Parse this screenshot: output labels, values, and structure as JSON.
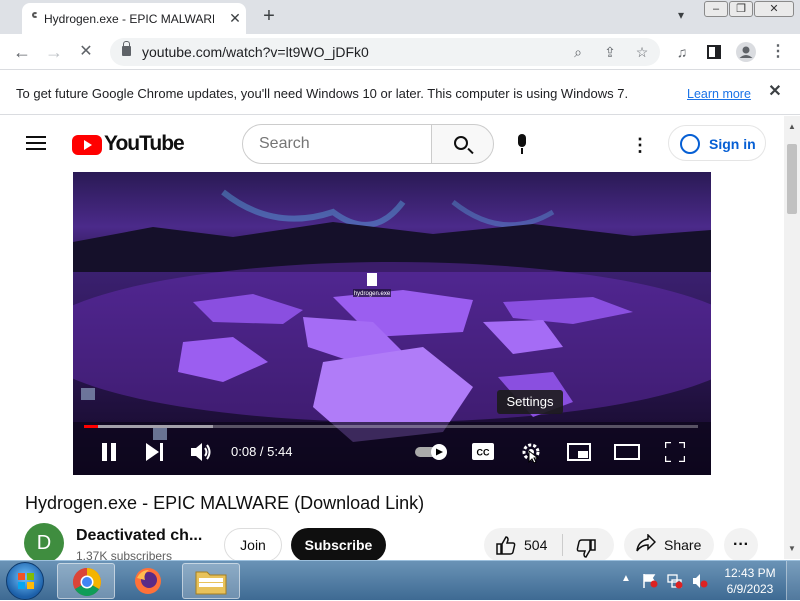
{
  "browser": {
    "tab_title": "Hydrogen.exe - EPIC MALWARE (",
    "url": "youtube.com/watch?v=lt9WO_jDFk0"
  },
  "update_bar": {
    "message": "To get future Google Chrome updates, you'll need Windows 10 or later. This computer is using Windows 7.",
    "link": "Learn more"
  },
  "youtube": {
    "logo_text": "YouTube",
    "search_placeholder": "Search",
    "sign_in": "Sign in"
  },
  "player": {
    "tooltip": "Settings",
    "current_time": "0:08",
    "duration": "5:44",
    "time_display": "0:08 / 5:44",
    "progress_fraction": 0.023,
    "buffered_fraction": 0.21,
    "autoplay_on": true
  },
  "video": {
    "title": "Hydrogen.exe - EPIC MALWARE (Download Link)",
    "channel_initial": "D",
    "channel_name": "Deactivated ch...",
    "subscribers": "1.37K subscribers",
    "join_label": "Join",
    "subscribe_label": "Subscribe",
    "likes": "504",
    "share_label": "Share"
  },
  "video_frame": {
    "desktop_file_label": "hydrogen.exe"
  },
  "taskbar": {
    "time": "12:43 PM",
    "date": "6/9/2023"
  },
  "colors": {
    "youtube_red": "#ff0000",
    "link_blue": "#065fd4",
    "taskbar": "#3e6a93"
  }
}
